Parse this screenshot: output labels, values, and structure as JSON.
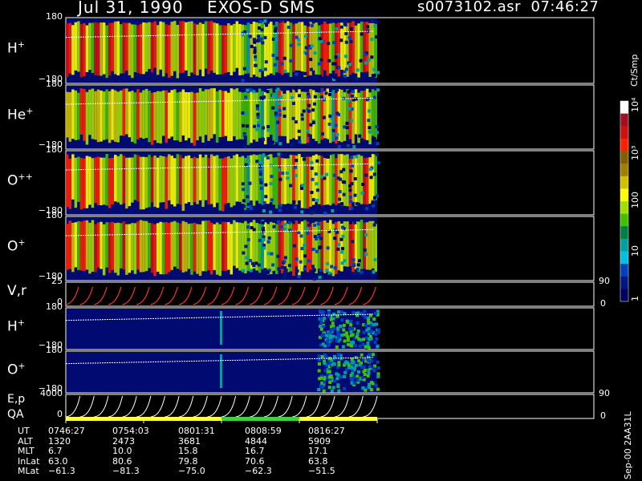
{
  "header": {
    "date": "Jul 31, 1990",
    "instrument": "EXOS-D SMS",
    "file": "s0073102.asr",
    "time": "07:46:27"
  },
  "chart_data": {
    "type": "heatmap",
    "panels": [
      {
        "label": "H",
        "sup": "+",
        "ymax": "180",
        "ymin": "−180",
        "kind": "spectrogram",
        "intensity": 1.0
      },
      {
        "label": "He",
        "sup": "+",
        "ymax": "180",
        "ymin": "−180",
        "kind": "spectrogram",
        "intensity": 0.75
      },
      {
        "label": "O",
        "sup": "++",
        "ymax": "180",
        "ymin": "−180",
        "kind": "spectrogram",
        "intensity": 0.85
      },
      {
        "label": "O",
        "sup": "+",
        "ymax": "180",
        "ymin": "−180",
        "kind": "spectrogram",
        "intensity": 0.9
      },
      {
        "label": "V,r",
        "sup": "",
        "ymax": "25",
        "ymin": "0",
        "right_top": "90",
        "right_bottom": "0",
        "kind": "lines"
      },
      {
        "label": "H",
        "sup": "+",
        "ymax": "180",
        "ymin": "−180",
        "kind": "quiet"
      },
      {
        "label": "O",
        "sup": "+",
        "ymax": "180",
        "ymin": "−180",
        "kind": "quiet"
      },
      {
        "label": "E,p",
        "label2": "QA",
        "ymax": "4000",
        "ymin": "0",
        "right_top": "90",
        "right_bottom": "0",
        "kind": "energy"
      }
    ],
    "colorbar": {
      "unit": "Ct/Smp",
      "ticks": [
        "10⁴",
        "10³",
        "100",
        "10",
        "1"
      ],
      "colors": [
        "#ffffff",
        "#a01020",
        "#d01010",
        "#ff2000",
        "#806000",
        "#a08000",
        "#d0c000",
        "#ffff00",
        "#a0e000",
        "#40c000",
        "#008040",
        "#00a0a0",
        "#00c0e0",
        "#0040c0",
        "#001880",
        "#000060"
      ]
    },
    "ephemeris": {
      "rows": [
        "UT",
        "ALT",
        "MLT",
        "InLat",
        "MLat"
      ],
      "columns": [
        {
          "UT": "0746:27",
          "ALT": "1320",
          "MLT": "6.7",
          "InLat": "63.0",
          "MLat": "−61.3"
        },
        {
          "UT": "0754:03",
          "ALT": "2473",
          "MLT": "10.0",
          "InLat": "80.6",
          "MLat": "−81.3"
        },
        {
          "UT": "0801:31",
          "ALT": "3681",
          "MLT": "15.8",
          "InLat": "79.8",
          "MLat": "−75.0"
        },
        {
          "UT": "0808:59",
          "ALT": "4844",
          "MLT": "16.7",
          "InLat": "70.6",
          "MLat": "−62.3"
        },
        {
          "UT": "0816:27",
          "ALT": "5909",
          "MLT": "17.1",
          "InLat": "63.8",
          "MLat": "−51.5"
        }
      ]
    },
    "qa_bar": [
      "#ffff40",
      "#ffff40",
      "#40d040",
      "#ffff40"
    ],
    "footer": "Sep-00 2AA31L"
  }
}
